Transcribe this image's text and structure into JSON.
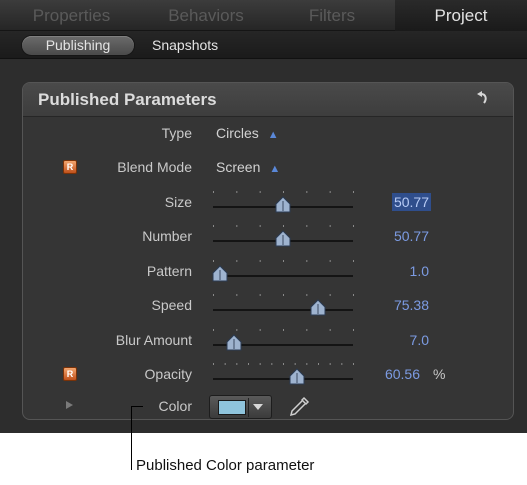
{
  "tabs": {
    "properties": "Properties",
    "behaviors": "Behaviors",
    "filters": "Filters",
    "project": "Project",
    "active": "Project"
  },
  "subtabs": {
    "publishing": "Publishing",
    "snapshots": "Snapshots",
    "active": "Publishing"
  },
  "panel": {
    "title": "Published Parameters",
    "reset_icon": "reset-arrow-icon"
  },
  "rig_badge": "R",
  "params": {
    "type": {
      "label": "Type",
      "value": "Circles"
    },
    "blend_mode": {
      "label": "Blend Mode",
      "value": "Screen",
      "rigged": true
    },
    "size": {
      "label": "Size",
      "value": "50.77",
      "slider": 0.5,
      "selected": true
    },
    "number": {
      "label": "Number",
      "value": "50.77",
      "slider": 0.5
    },
    "pattern": {
      "label": "Pattern",
      "value": "1.0",
      "slider": 0.05
    },
    "speed": {
      "label": "Speed",
      "value": "75.38",
      "slider": 0.75
    },
    "blur_amount": {
      "label": "Blur Amount",
      "value": "7.0",
      "slider": 0.15
    },
    "opacity": {
      "label": "Opacity",
      "value": "60.56",
      "unit": "%",
      "slider": 0.6,
      "rigged": true
    },
    "color": {
      "label": "Color",
      "swatch": "#8fc4dc",
      "icon": "eyedropper-icon"
    }
  },
  "callout": "Published Color parameter",
  "colors": {
    "value_text": "#7c9be2",
    "selection": "#2f4e8c",
    "rig_badge": "#e07a3c"
  }
}
